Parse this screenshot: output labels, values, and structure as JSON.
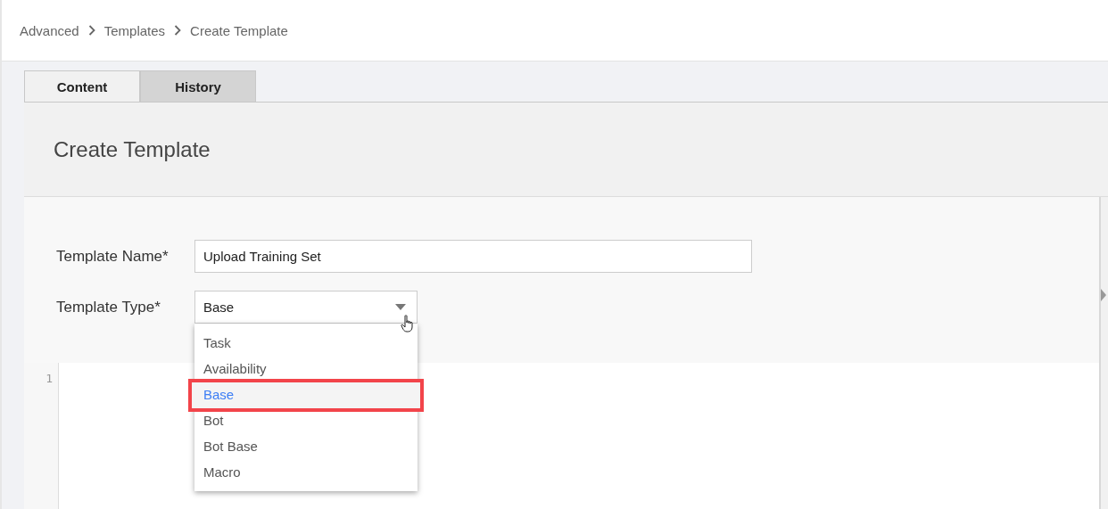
{
  "breadcrumb": [
    "Advanced",
    "Templates",
    "Create Template"
  ],
  "tabs": [
    {
      "label": "Content",
      "selected": true
    },
    {
      "label": "History",
      "selected": false
    }
  ],
  "panel": {
    "title": "Create Template"
  },
  "form": {
    "name_label": "Template Name*",
    "name_value": "Upload Training Set",
    "type_label": "Template Type*",
    "type_value": "Base",
    "dropdown_open": true,
    "options": [
      {
        "label": "Task",
        "selected": false,
        "outlined": false
      },
      {
        "label": "Availability",
        "selected": false,
        "outlined": false
      },
      {
        "label": "Base",
        "selected": true,
        "outlined": true
      },
      {
        "label": "Bot",
        "selected": false,
        "outlined": false
      },
      {
        "label": "Bot Base",
        "selected": false,
        "outlined": false
      },
      {
        "label": "Macro",
        "selected": false,
        "outlined": false
      }
    ]
  },
  "editor": {
    "line_numbers": [
      "1"
    ]
  }
}
